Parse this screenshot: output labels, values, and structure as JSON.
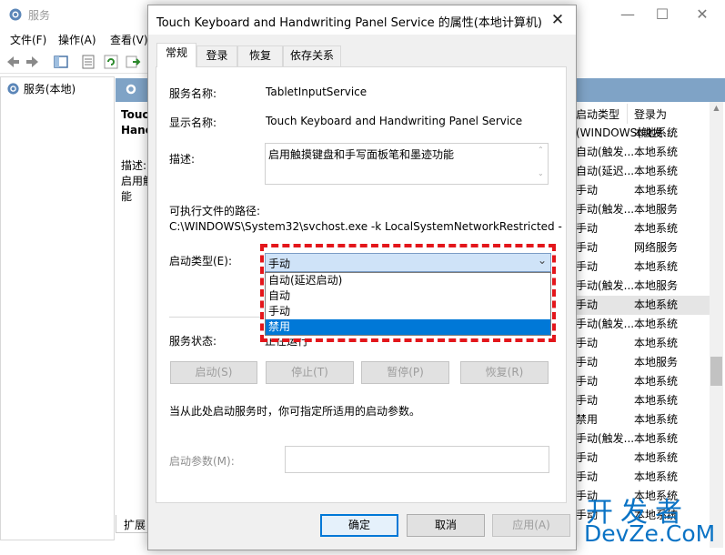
{
  "background_window": {
    "title": "服务",
    "menu": [
      "文件(F)",
      "操作(A)",
      "查看(V)"
    ],
    "tree_item": "服务(本地)",
    "middle_text": [
      "Touc",
      "Hanc",
      "描述:",
      "启用触",
      "能"
    ],
    "bottom_tab": "扩展",
    "columns": [
      "启动类型",
      "登录为"
    ],
    "rows": [
      {
        "type": "(WINDOWS(触发...",
        "logon": "本地系统"
      },
      {
        "type": "自动(触发...",
        "logon": "本地系统"
      },
      {
        "type": "自动(延迟...",
        "logon": "本地系统"
      },
      {
        "type": "手动",
        "logon": "本地系统"
      },
      {
        "type": "手动(触发...",
        "logon": "本地服务"
      },
      {
        "type": "手动",
        "logon": "本地系统"
      },
      {
        "type": "手动",
        "logon": "网络服务"
      },
      {
        "type": "手动",
        "logon": "本地系统"
      },
      {
        "type": "手动(触发...",
        "logon": "本地服务"
      },
      {
        "type": "手动",
        "logon": "本地系统"
      },
      {
        "type": "手动(触发...",
        "logon": "本地系统"
      },
      {
        "type": "手动",
        "logon": "本地系统"
      },
      {
        "type": "手动",
        "logon": "本地服务"
      },
      {
        "type": "手动",
        "logon": "本地系统"
      },
      {
        "type": "手动",
        "logon": "本地系统"
      },
      {
        "type": "禁用",
        "logon": "本地系统"
      },
      {
        "type": "手动(触发...",
        "logon": "本地系统"
      },
      {
        "type": "手动",
        "logon": "本地系统"
      },
      {
        "type": "手动",
        "logon": "本地系统"
      },
      {
        "type": "手动",
        "logon": "本地系统"
      },
      {
        "type": "手动",
        "logon": "本地系统"
      }
    ]
  },
  "dialog": {
    "title": "Touch Keyboard and Handwriting Panel Service 的属性(本地计算机)",
    "close": "✕",
    "tabs": [
      "常规",
      "登录",
      "恢复",
      "依存关系"
    ],
    "service_name_label": "服务名称:",
    "service_name": "TabletInputService",
    "display_name_label": "显示名称:",
    "display_name": "Touch Keyboard and Handwriting Panel Service",
    "description_label": "描述:",
    "description": "启用触摸键盘和手写面板笔和墨迹功能",
    "path_label": "可执行文件的路径:",
    "path": "C:\\WINDOWS\\System32\\svchost.exe -k LocalSystemNetworkRestricted -",
    "startup_type_label": "启动类型(E):",
    "startup_type_value": "手动",
    "startup_options": [
      "自动(延迟启动)",
      "自动",
      "手动",
      "禁用"
    ],
    "startup_selected_option": "禁用",
    "service_status_label": "服务状态:",
    "service_status": "正在运行",
    "buttons": {
      "start": "启动(S)",
      "stop": "停止(T)",
      "pause": "暂停(P)",
      "resume": "恢复(R)"
    },
    "hint": "当从此处启动服务时，你可指定所适用的启动参数。",
    "param_label": "启动参数(M):",
    "param_value": "",
    "footer": {
      "ok": "确定",
      "cancel": "取消",
      "apply": "应用(A)"
    }
  },
  "watermark": {
    "cn": "开发者",
    "en": "DevZe.CoM"
  },
  "colors": {
    "accent": "#0078d7",
    "highlight_box": "#e3161b",
    "column_header": "#7fa3c6",
    "watermark": "#0a73c5"
  }
}
